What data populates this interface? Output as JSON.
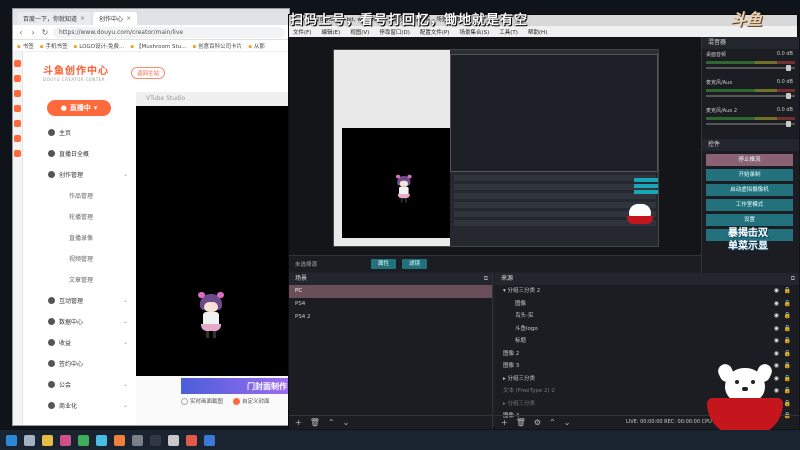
{
  "overlay": {
    "top_caption": "扫码上号，看号打回忆，锄地就是有空",
    "brand_logo": "斗鱼",
    "side_text_1": "暴揭击双",
    "side_text_2": "单菜示显"
  },
  "browser": {
    "tabs": [
      {
        "label": "百度一下，你就知道"
      },
      {
        "label": "创作中心"
      }
    ],
    "url": "https://www.douyu.com/creator/main/live",
    "bookmarks": [
      "书签",
      "手机书签",
      "LOGO设计-免费...",
      "【Mushroom Stu...",
      "创意百科公司卡片",
      "从那"
    ],
    "logo": "斗鱼创作中心",
    "logo_sub": "DOUYU CREATOR CENTER",
    "switch_label": "返回主站",
    "live_button": "直播中",
    "nav_items": [
      {
        "label": "主页",
        "sub": false,
        "chev": false
      },
      {
        "label": "直播日全概",
        "sub": false,
        "chev": false
      },
      {
        "label": "创作管理",
        "sub": false,
        "chev": true
      },
      {
        "label": "作品管理",
        "sub": true,
        "chev": false
      },
      {
        "label": "轮播管理",
        "sub": true,
        "chev": false
      },
      {
        "label": "直播录像",
        "sub": true,
        "chev": false
      },
      {
        "label": "视频管理",
        "sub": true,
        "chev": false
      },
      {
        "label": "文章管理",
        "sub": true,
        "chev": false
      },
      {
        "label": "互动管理",
        "sub": false,
        "chev": true
      },
      {
        "label": "数据中心",
        "sub": false,
        "chev": true
      },
      {
        "label": "收益",
        "sub": false,
        "chev": true
      },
      {
        "label": "签约中心",
        "sub": false,
        "chev": false
      },
      {
        "label": "公会",
        "sub": false,
        "chev": true
      },
      {
        "label": "商业化",
        "sub": false,
        "chev": true
      }
    ],
    "vtube_label": "VTube Studio",
    "banner_text": "门封面制作",
    "radio_options": [
      {
        "label": "实时画面截图",
        "on": false
      },
      {
        "label": "自定义封面",
        "on": true
      }
    ]
  },
  "obs": {
    "title": "OBS 28.0.2 (64-bit, windows) - 配置文件: 未命名 - 场景: 未命名",
    "menu": [
      "文件(F)",
      "编辑(E)",
      "视图(V)",
      "停靠窗口(D)",
      "配置文件(P)",
      "场景集合(S)",
      "工具(T)",
      "帮助(H)"
    ],
    "trans_label": "未选择源",
    "btn_props": "属性",
    "btn_filters": "滤镜",
    "scenes_title": "场景",
    "scenes": [
      {
        "label": "PC",
        "selected": true
      },
      {
        "label": "PS4",
        "selected": false
      },
      {
        "label": "PS4 2",
        "selected": false
      }
    ],
    "sources_title": "来源",
    "sources": [
      {
        "label": "▾ 分组三分类 2",
        "indent": false,
        "dim": false
      },
      {
        "label": "图像",
        "indent": true,
        "dim": false
      },
      {
        "label": "鸟头-实",
        "indent": true,
        "dim": false
      },
      {
        "label": "斗鱼logo",
        "indent": true,
        "dim": false
      },
      {
        "label": "标题",
        "indent": true,
        "dim": false
      },
      {
        "label": "图像 2",
        "indent": false,
        "dim": false
      },
      {
        "label": "图像 3",
        "indent": false,
        "dim": false
      },
      {
        "label": "▸ 分组三分类",
        "indent": false,
        "dim": false
      },
      {
        "label": "文本 (FreeType 2) 2",
        "indent": false,
        "dim": true
      },
      {
        "label": "▸ 分组三分类",
        "indent": false,
        "dim": true
      },
      {
        "label": "图像 4",
        "indent": false,
        "dim": false
      }
    ],
    "mixer_title": "混音器",
    "mixer": [
      {
        "label": "桌面音频",
        "db": "0.0 dB"
      },
      {
        "label": "麦克风/Aux",
        "db": "0.0 dB"
      },
      {
        "label": "麦克风/Aux 2",
        "db": "0.0 dB"
      }
    ],
    "controls_title": "控件",
    "controls": [
      {
        "label": "停止推流",
        "stop": true
      },
      {
        "label": "开始录制",
        "stop": false
      },
      {
        "label": "启动虚拟摄像机",
        "stop": false
      },
      {
        "label": "工作室模式",
        "stop": false
      },
      {
        "label": "设置",
        "stop": false
      },
      {
        "label": "退出",
        "stop": false
      }
    ],
    "status": "LIVE: 00:00:00    REC: 00:00:00    CPU"
  }
}
